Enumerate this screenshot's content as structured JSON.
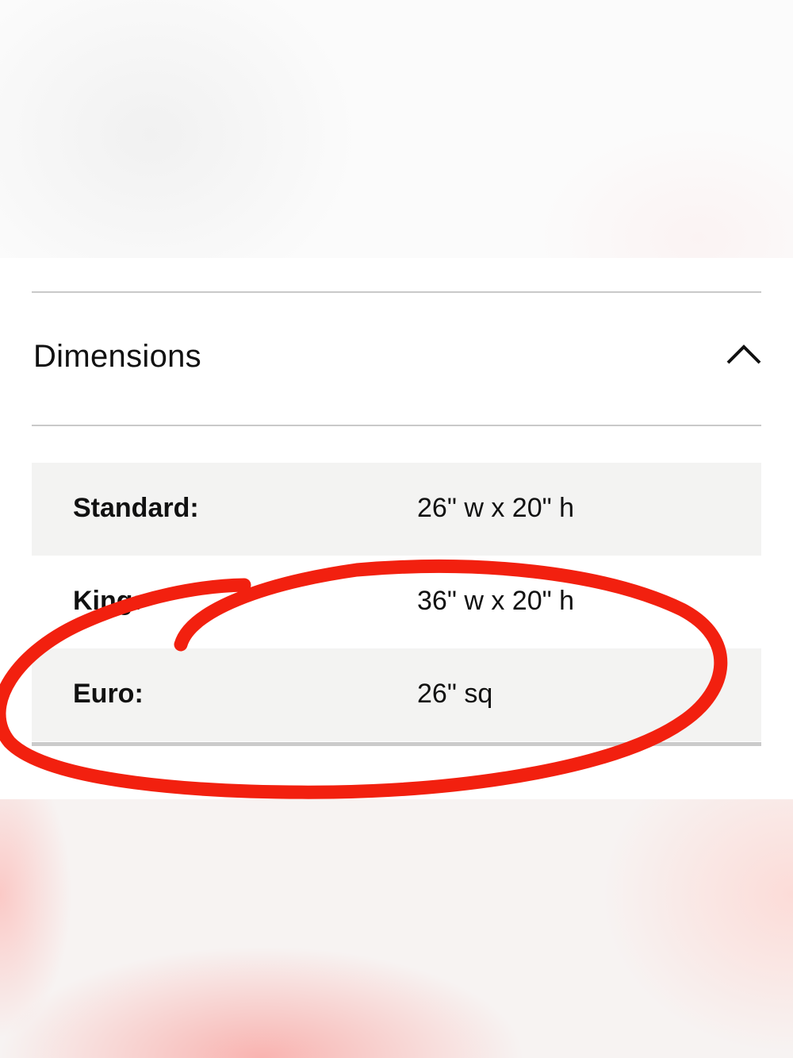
{
  "dimensions_section": {
    "title": "Dimensions",
    "expanded": true,
    "toggle_icon": "chevron-up-icon",
    "rows": [
      {
        "label": "Standard:",
        "value": "26\" w x 20\" h"
      },
      {
        "label": "King:",
        "value": "36\" w x 20\" h"
      },
      {
        "label": "Euro:",
        "value": "26\" sq"
      }
    ]
  },
  "annotation": {
    "shape": "hand-drawn-circle",
    "color": "#f2200f"
  }
}
